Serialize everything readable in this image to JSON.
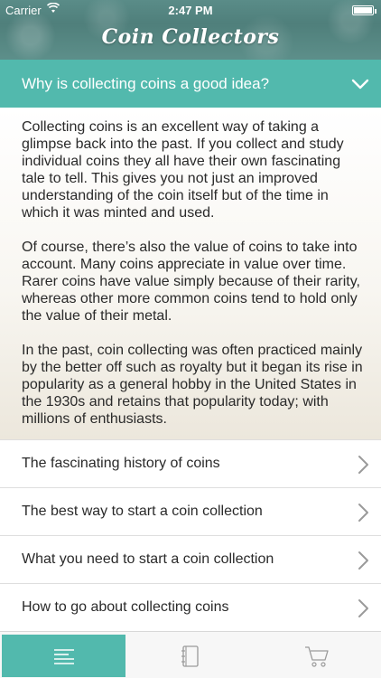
{
  "status_bar": {
    "carrier": "Carrier",
    "time": "2:47 PM"
  },
  "app_title": "Coin Collectors",
  "expanded_section": {
    "title": "Why is collecting coins a good idea?",
    "paragraphs": [
      "Collecting coins is an excellent way of taking a glimpse back into the past. If you collect and study individual coins they all have their own fascinating tale to tell. This gives you not just an improved understanding of the coin itself but of the time in which it was minted and used.",
      "Of course, there’s also the value of coins to take into account. Many coins appreciate in value over time. Rarer coins have value simply because of their rarity, whereas other more common coins tend to hold only the value of their metal.",
      "In the past, coin collecting was often practiced mainly by the better off such as royalty but it began its rise in popularity as a general hobby in the United States in the 1930s and retains that popularity today; with millions of enthusiasts."
    ]
  },
  "list_items": [
    {
      "label": "The fascinating history of coins"
    },
    {
      "label": "The best way to start a coin collection"
    },
    {
      "label": "What you need to start a coin collection"
    },
    {
      "label": "How to go about collecting coins"
    }
  ],
  "tabs": [
    {
      "icon": "list-icon",
      "active": true
    },
    {
      "icon": "book-icon",
      "active": false
    },
    {
      "icon": "cart-icon",
      "active": false
    }
  ],
  "colors": {
    "accent": "#52b9ad",
    "header": "#5a8c88"
  }
}
